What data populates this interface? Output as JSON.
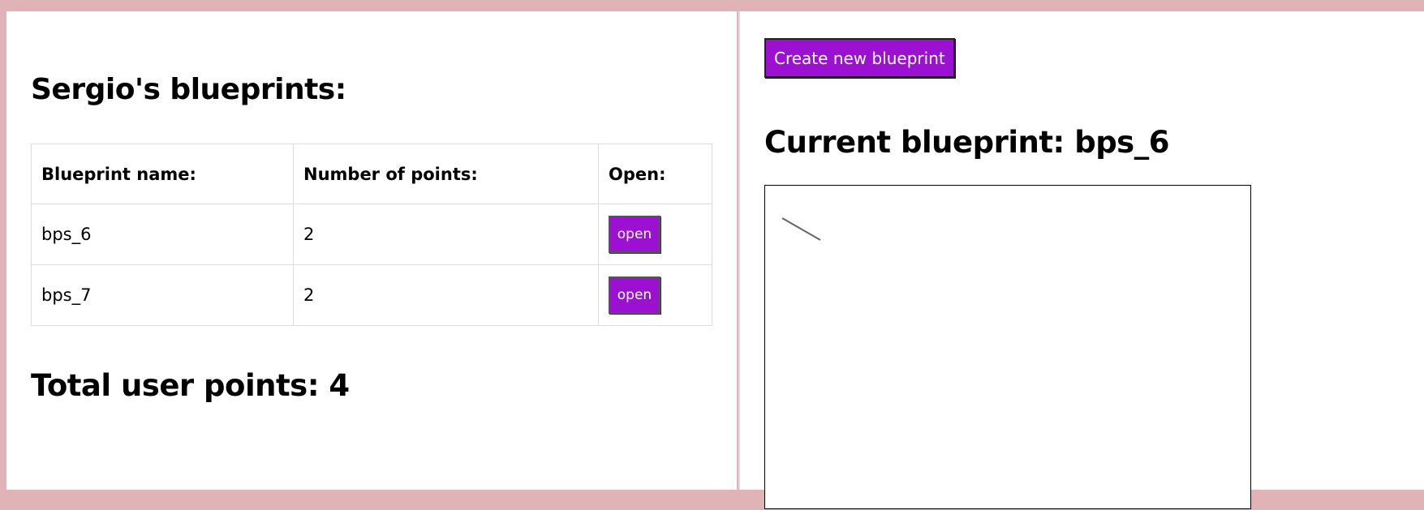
{
  "left": {
    "title": "Sergio's blueprints:",
    "table": {
      "headers": [
        "Blueprint name:",
        "Number of points:",
        "Open:"
      ],
      "rows": [
        {
          "name": "bps_6",
          "points": "2",
          "button": "open"
        },
        {
          "name": "bps_7",
          "points": "2",
          "button": "open"
        }
      ]
    },
    "total_label": "Total user points: 4"
  },
  "right": {
    "create_button": "Create new blueprint",
    "current_label": "Current blueprint: bps_6"
  },
  "colors": {
    "background": "#e0b4b6",
    "button": "#9b10d1"
  }
}
